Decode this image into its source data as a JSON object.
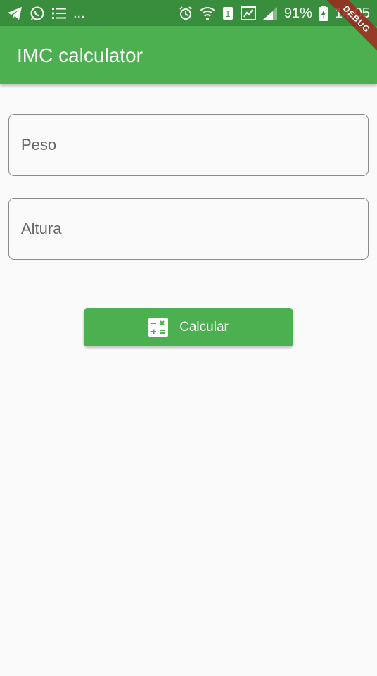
{
  "status_bar": {
    "left_icons": [
      "telegram-icon",
      "whatsapp-icon",
      "list-icon"
    ],
    "overflow_text": "...",
    "right_icons": [
      "alarm-icon",
      "wifi-icon",
      "sim-1-icon",
      "sim-card-icon",
      "signal-icon"
    ],
    "battery_text": "91%",
    "time": "14:05"
  },
  "app_bar": {
    "title": "IMC calculator"
  },
  "debug_banner": "DEBUG",
  "form": {
    "peso": {
      "placeholder": "Peso",
      "value": ""
    },
    "altura": {
      "placeholder": "Altura",
      "value": ""
    }
  },
  "calculate_button": {
    "label": "Calcular",
    "icon": "calculator-icon"
  },
  "colors": {
    "primary": "#4caf50",
    "primary_dark": "#388e3c",
    "background": "#fafafa",
    "field_border": "#8a8a8a"
  }
}
